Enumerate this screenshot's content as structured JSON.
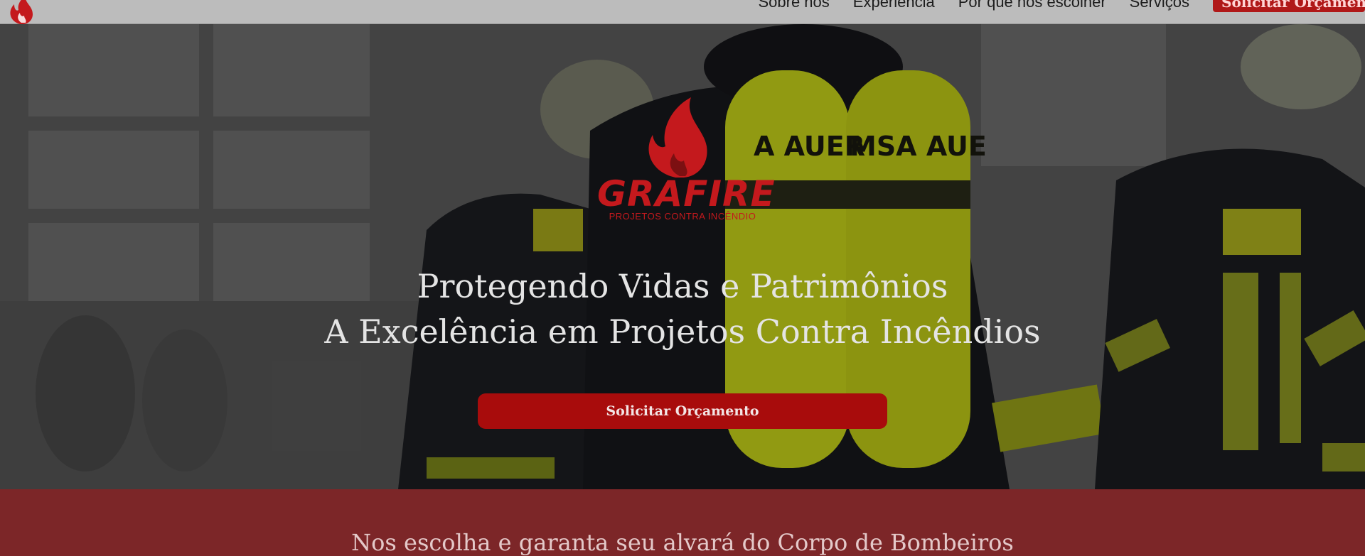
{
  "nav": {
    "links": [
      "Sobre nós",
      "Experiência",
      "Por que nos escolher",
      "Serviços"
    ],
    "cta_label": "Solicitar Orçamento"
  },
  "hero": {
    "brand_name": "GRAFIRE",
    "brand_tagline": "PROJETOS CONTRA INCÊNDIO",
    "headline_line1": "Protegendo Vidas e Patrimônios",
    "headline_line2": "A Excelência em Projetos Contra Incêndios",
    "cta_label": "Solicitar Orçamento"
  },
  "section": {
    "title": "Nos escolha e garanta seu alvará do Corpo de Bombeiros"
  },
  "colors": {
    "brand_red": "#c4191d",
    "cta_red": "#a80c0c",
    "band_red": "#7c2628"
  }
}
